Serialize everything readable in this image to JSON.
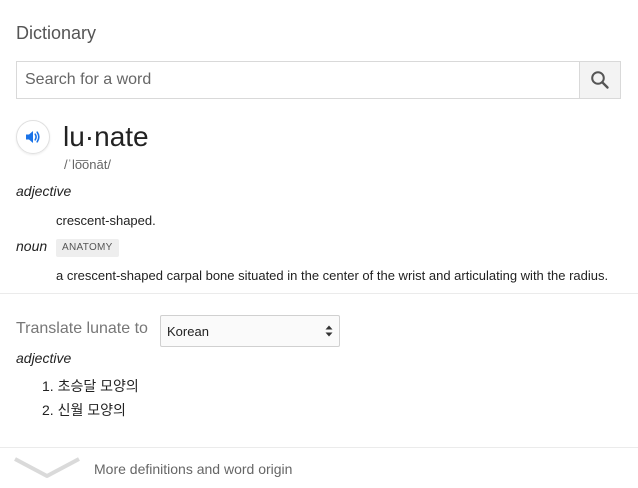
{
  "header": {
    "title": "Dictionary"
  },
  "search": {
    "placeholder": "Search for a word",
    "icon": "search-icon"
  },
  "entry": {
    "headword": "lu·nate",
    "phonetic": "/ˈlo͞onāt/",
    "senses": [
      {
        "pos": "adjective",
        "definition": "crescent-shaped."
      },
      {
        "pos": "noun",
        "tag": "ANATOMY",
        "definition": "a crescent-shaped carpal bone situated in the center of the wrist and articulating with the radius."
      }
    ]
  },
  "translate": {
    "label": "Translate lunate to",
    "language": "Korean",
    "pos": "adjective",
    "items": [
      "1. 초승달 모양의",
      "2. 신월 모양의"
    ]
  },
  "footer": {
    "more_label": "More definitions and word origin"
  },
  "colors": {
    "accent": "#1a73e8",
    "divider": "#ebebeb",
    "chevron": "#dadada"
  }
}
